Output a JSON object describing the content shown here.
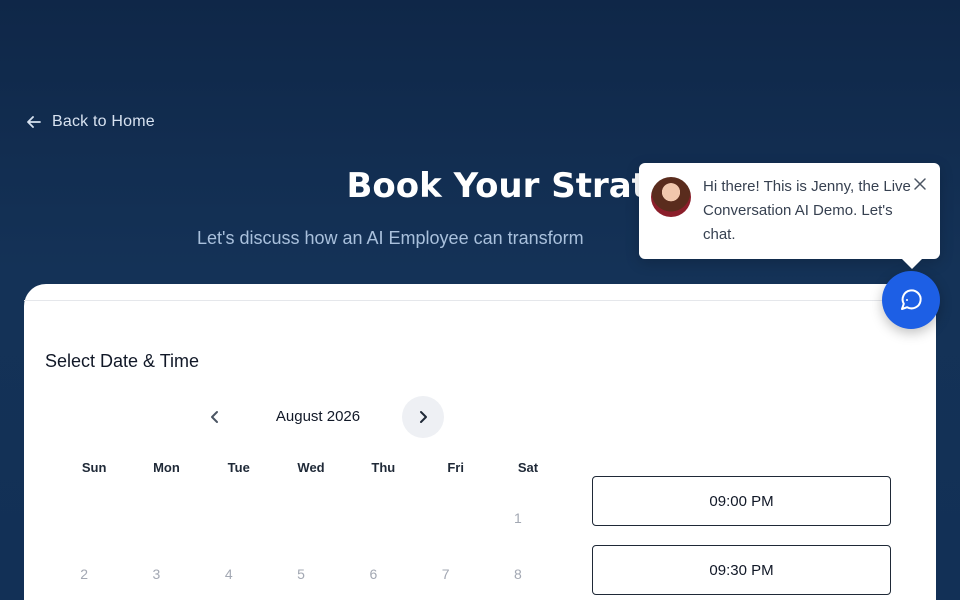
{
  "nav": {
    "back_label": "Back to Home"
  },
  "header": {
    "title": "Book Your Strategy",
    "subtitle": "Let's discuss how an AI Employee can transform"
  },
  "booking": {
    "section_title": "Select Date & Time",
    "calendar": {
      "month_label": "August 2026",
      "weekdays": [
        "Sun",
        "Mon",
        "Tue",
        "Wed",
        "Thu",
        "Fri",
        "Sat"
      ],
      "days": [
        "",
        "",
        "",
        "",
        "",
        "",
        "1",
        "2",
        "3",
        "4",
        "5",
        "6",
        "7",
        "8"
      ]
    },
    "time_slots": [
      "09:00 PM",
      "09:30 PM"
    ]
  },
  "chat_popup": {
    "message": "Hi there! This is Jenny, the Live Conversation AI Demo. Let's chat."
  },
  "icons": {
    "back": "arrow-left-icon",
    "prev": "chevron-left-icon",
    "next": "chevron-right-icon",
    "close": "close-icon",
    "chat": "chat-bubble-icon"
  },
  "colors": {
    "background": "#143257",
    "accent": "#1d5fe5",
    "card": "#ffffff"
  }
}
